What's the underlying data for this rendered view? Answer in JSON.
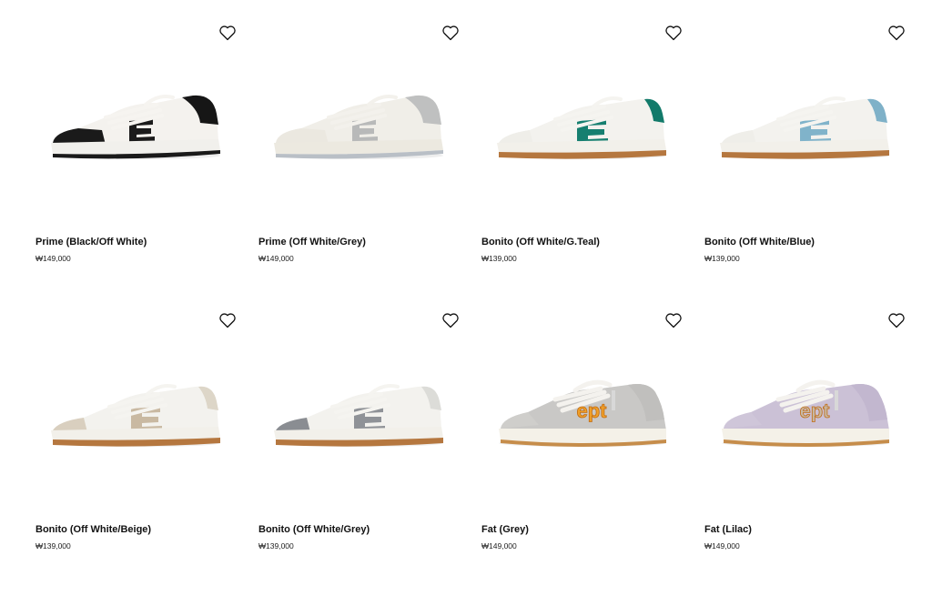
{
  "products": [
    {
      "name": "Prime (Black/Off White)",
      "price": "₩149,000",
      "style": "prime",
      "colors": {
        "upper": "#f4f2ee",
        "heel": "#161616",
        "toe": "#1a1a1a",
        "accent": "#1b1b1b",
        "sole": "#f1f0ec",
        "soleEdge": "#1a1a1a",
        "laces": "#f6f4f0"
      }
    },
    {
      "name": "Prime (Off White/Grey)",
      "price": "₩149,000",
      "style": "prime",
      "colors": {
        "upper": "#f0eee8",
        "heel": "#bfc0c0",
        "toe": "#ebe8e0",
        "accent": "#b8b9b9",
        "sole": "#ece9e0",
        "soleEdge": "#b9bfc6",
        "laces": "#f3f1ec"
      }
    },
    {
      "name": "Bonito (Off White/G.Teal)",
      "price": "₩139,000",
      "style": "bonito",
      "colors": {
        "upper": "#f3f2ee",
        "heel": "#127a6a",
        "toe": "#efeee9",
        "accent": "#167f70",
        "sole": "#f2f0ea",
        "soleEdge": "#b5773f",
        "laces": "#f5f4f0"
      }
    },
    {
      "name": "Bonito (Off White/Blue)",
      "price": "₩139,000",
      "style": "bonito",
      "colors": {
        "upper": "#f3f2ee",
        "heel": "#7fb1c8",
        "toe": "#efeee9",
        "accent": "#80b3ca",
        "sole": "#f2f0ea",
        "soleEdge": "#b5773f",
        "laces": "#f5f4f0"
      }
    },
    {
      "name": "Bonito (Off White/Beige)",
      "price": "₩139,000",
      "style": "bonito",
      "colors": {
        "upper": "#f3f2ee",
        "heel": "#ddd6c8",
        "toe": "#d9cfbf",
        "accent": "#c9b9a2",
        "sole": "#f2f0ea",
        "soleEdge": "#b5773f",
        "laces": "#f5f4f0"
      }
    },
    {
      "name": "Bonito (Off White/Grey)",
      "price": "₩139,000",
      "style": "bonito",
      "colors": {
        "upper": "#f3f2ee",
        "heel": "#dcdcd8",
        "toe": "#8a8d92",
        "accent": "#8f9297",
        "sole": "#f2f0ea",
        "soleEdge": "#b5773f",
        "laces": "#f5f4f0"
      }
    },
    {
      "name": "Fat (Grey)",
      "price": "₩149,000",
      "style": "fat",
      "colors": {
        "upper": "#c9c8c6",
        "heel": "#c0bfbd",
        "toe": "#cfcecb",
        "accent": "#f0a028",
        "sole": "#f4f1e8",
        "soleEdge": "#c68d4b",
        "laces": "#f4f2ee"
      }
    },
    {
      "name": "Fat (Lilac)",
      "price": "₩149,000",
      "style": "fat",
      "colors": {
        "upper": "#cbc1d6",
        "heel": "#c2b7cf",
        "toe": "#cfc6d9",
        "accent": "#c7b9a5",
        "sole": "#f4f1e8",
        "soleEdge": "#c68d4b",
        "laces": "#f4f2ee"
      }
    }
  ],
  "badge_text": "ept"
}
